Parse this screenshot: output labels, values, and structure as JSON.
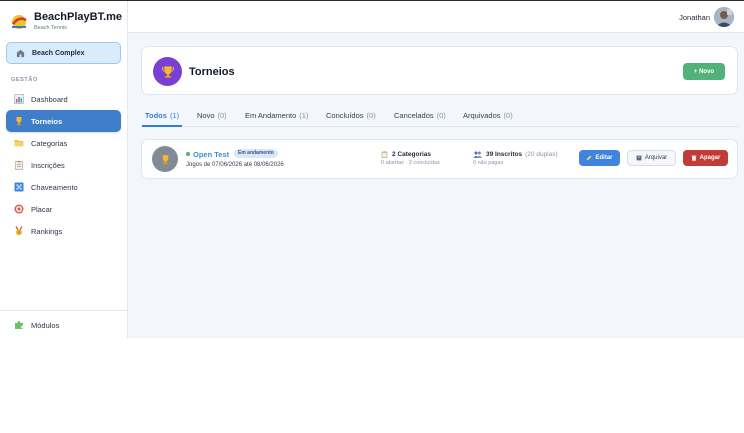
{
  "brand": {
    "name": "BeachPlayBT.me",
    "subtitle": "Beach Tennis"
  },
  "complex": {
    "label": "Beach Complex",
    "icon": "building-icon"
  },
  "sidebar": {
    "section_label": "GESTÃO",
    "items": [
      {
        "label": "Dashboard",
        "icon": "bar-chart-icon",
        "active": false
      },
      {
        "label": "Torneios",
        "icon": "trophy-icon",
        "active": true
      },
      {
        "label": "Categorias",
        "icon": "folder-icon",
        "active": false
      },
      {
        "label": "Inscrições",
        "icon": "clipboard-icon",
        "active": false
      },
      {
        "label": "Chaveamento",
        "icon": "bracket-icon",
        "active": false
      },
      {
        "label": "Placar",
        "icon": "target-icon",
        "active": false
      },
      {
        "label": "Rankings",
        "icon": "medal-icon",
        "active": false
      }
    ],
    "modules_label": "Módulos",
    "modules_icon": "puzzle-icon"
  },
  "topbar": {
    "username": "Jonathan"
  },
  "header": {
    "title": "Torneios",
    "new_button": "+ Novo"
  },
  "tabs": [
    {
      "label": "Todos",
      "count": "(1)",
      "active": true
    },
    {
      "label": "Novo",
      "count": "(0)",
      "active": false
    },
    {
      "label": "Em Andamento",
      "count": "(1)",
      "active": false
    },
    {
      "label": "Concluídos",
      "count": "(0)",
      "active": false
    },
    {
      "label": "Cancelados",
      "count": "(0)",
      "active": false
    },
    {
      "label": "Arquivados",
      "count": "(0)",
      "active": false
    }
  ],
  "tournament": {
    "name": "Open Test",
    "status_badge": "Em andamento",
    "dates": "Jogos de 07/06/2026 até 08/06/2026",
    "categories_main": "2 Categorias",
    "categories_sub": "0 abertas · 2 concluídas",
    "inscritos_main": "39 Inscritos",
    "inscritos_extra": "(20 duplas)",
    "inscritos_sub": "0 não pagas",
    "buttons": {
      "edit": "Editar",
      "archive": "Arquivar",
      "delete": "Apagar"
    }
  },
  "colors": {
    "primary": "#3f7ec9",
    "success": "#52b27a",
    "danger": "#c23b36",
    "trophy_bg": "#7b3fd6",
    "link": "#3a8fd8"
  }
}
